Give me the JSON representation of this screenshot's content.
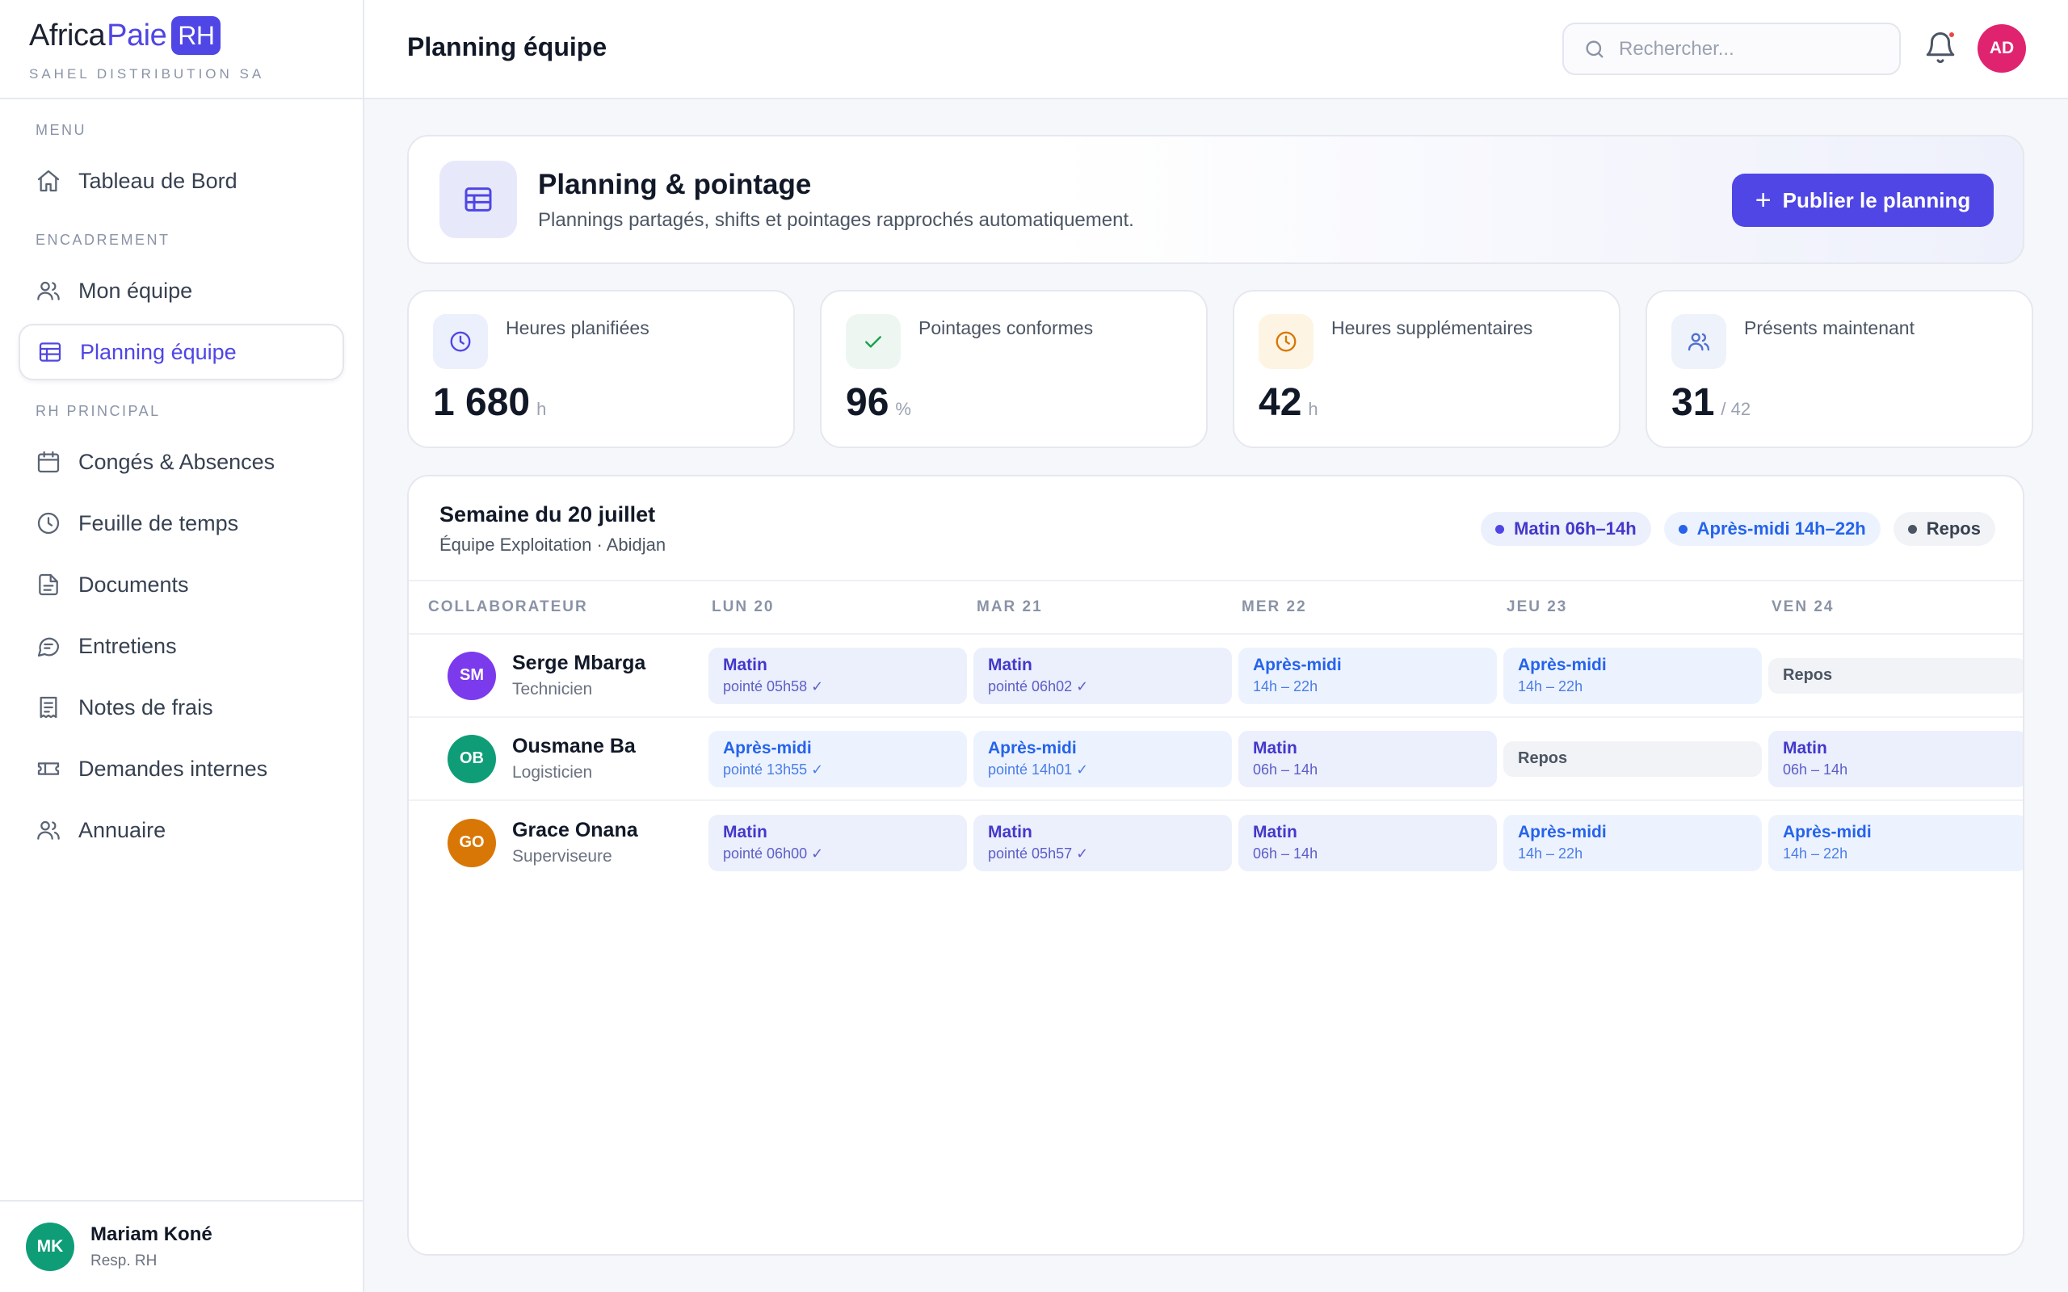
{
  "brand": {
    "name_part1": "Africa",
    "name_part2": "Paie",
    "badge": "RH",
    "company": "SAHEL DISTRIBUTION SA"
  },
  "sidebar": {
    "sections": [
      {
        "label": "MENU",
        "items": [
          {
            "label": "Tableau de Bord",
            "icon": "home-icon",
            "active": false
          }
        ]
      },
      {
        "label": "ENCADREMENT",
        "items": [
          {
            "label": "Mon équipe",
            "icon": "users-icon",
            "active": false
          },
          {
            "label": "Planning équipe",
            "icon": "table-icon",
            "active": true
          }
        ]
      },
      {
        "label": "RH PRINCIPAL",
        "items": [
          {
            "label": "Congés & Absences",
            "icon": "calendar-icon",
            "active": false
          },
          {
            "label": "Feuille de temps",
            "icon": "clock-icon",
            "active": false
          },
          {
            "label": "Documents",
            "icon": "document-icon",
            "active": false
          },
          {
            "label": "Entretiens",
            "icon": "chat-icon",
            "active": false
          },
          {
            "label": "Notes de frais",
            "icon": "receipt-icon",
            "active": false
          },
          {
            "label": "Demandes internes",
            "icon": "ticket-icon",
            "active": false
          },
          {
            "label": "Annuaire",
            "icon": "users-icon",
            "active": false
          }
        ]
      }
    ],
    "user": {
      "initials": "MK",
      "name": "Mariam Koné",
      "role": "Resp. RH",
      "color": "#0f9d78"
    }
  },
  "header": {
    "title": "Planning équipe",
    "search_placeholder": "Rechercher...",
    "avatar_initials": "AD",
    "avatar_color": "#e0236f"
  },
  "hero": {
    "title": "Planning & pointage",
    "subtitle": "Plannings partagés, shifts et pointages rapprochés automatiquement.",
    "button_label": "Publier le planning"
  },
  "stats": [
    {
      "label": "Heures planifiées",
      "value": "1 680",
      "unit": "h",
      "icon": "clock-icon",
      "bg": "#eceffc",
      "fg": "#4f46e5"
    },
    {
      "label": "Pointages conformes",
      "value": "96",
      "unit": "%",
      "icon": "check-icon",
      "bg": "#eef6f2",
      "fg": "#16a34a"
    },
    {
      "label": "Heures supplémentaires",
      "value": "42",
      "unit": "h",
      "icon": "clock-icon",
      "bg": "#fdf4e3",
      "fg": "#d97706"
    },
    {
      "label": "Présents maintenant",
      "value": "31",
      "unit": "/ 42",
      "icon": "users-icon",
      "bg": "#eef2fb",
      "fg": "#4f6fd0"
    }
  ],
  "planning": {
    "title": "Semaine du 20 juillet",
    "subtitle": "Équipe Exploitation · Abidjan",
    "legend": [
      {
        "label": "Matin 06h–14h",
        "bg": "#eceffc",
        "fg": "#4338ca",
        "dot": "#4f46e5"
      },
      {
        "label": "Après-midi 14h–22h",
        "bg": "#edf3fe",
        "fg": "#2563eb",
        "dot": "#2563eb"
      },
      {
        "label": "Repos",
        "bg": "#f1f3f6",
        "fg": "#374151",
        "dot": "#4b5563"
      }
    ],
    "columns": [
      "COLLABORATEUR",
      "LUN 20",
      "MAR 21",
      "MER 22",
      "JEU 23",
      "VEN 24"
    ],
    "rows": [
      {
        "initials": "SM",
        "color": "#7c3aed",
        "name": "Serge Mbarga",
        "role": "Technicien",
        "shifts": [
          {
            "type": "matin",
            "title": "Matin",
            "detail": "pointé 05h58 ✓"
          },
          {
            "type": "matin",
            "title": "Matin",
            "detail": "pointé 06h02 ✓"
          },
          {
            "type": "apres",
            "title": "Après-midi",
            "detail": "14h – 22h"
          },
          {
            "type": "apres",
            "title": "Après-midi",
            "detail": "14h – 22h"
          },
          {
            "type": "repos",
            "title": "Repos",
            "detail": ""
          }
        ]
      },
      {
        "initials": "OB",
        "color": "#0f9d78",
        "name": "Ousmane Ba",
        "role": "Logisticien",
        "shifts": [
          {
            "type": "apres",
            "title": "Après-midi",
            "detail": "pointé 13h55 ✓"
          },
          {
            "type": "apres",
            "title": "Après-midi",
            "detail": "pointé 14h01 ✓"
          },
          {
            "type": "matin",
            "title": "Matin",
            "detail": "06h – 14h"
          },
          {
            "type": "repos",
            "title": "Repos",
            "detail": ""
          },
          {
            "type": "matin",
            "title": "Matin",
            "detail": "06h – 14h"
          }
        ]
      },
      {
        "initials": "GO",
        "color": "#d97706",
        "name": "Grace Onana",
        "role": "Superviseure",
        "shifts": [
          {
            "type": "matin",
            "title": "Matin",
            "detail": "pointé 06h00 ✓"
          },
          {
            "type": "matin",
            "title": "Matin",
            "detail": "pointé 05h57 ✓"
          },
          {
            "type": "matin",
            "title": "Matin",
            "detail": "06h – 14h"
          },
          {
            "type": "apres",
            "title": "Après-midi",
            "detail": "14h – 22h"
          },
          {
            "type": "apres",
            "title": "Après-midi",
            "detail": "14h – 22h"
          }
        ]
      }
    ]
  }
}
